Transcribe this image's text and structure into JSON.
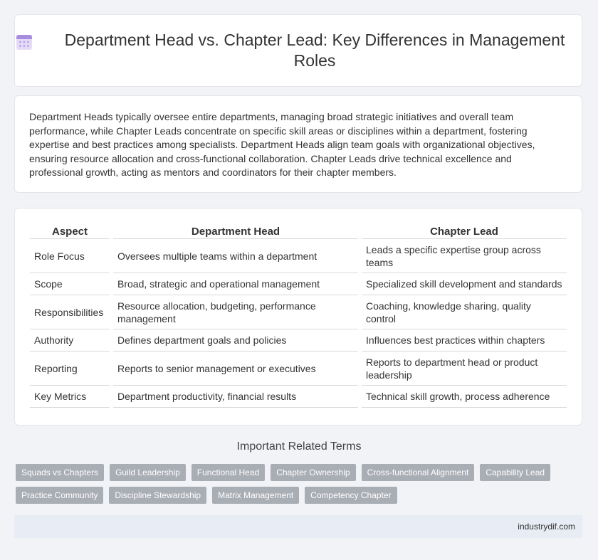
{
  "header": {
    "title": "Department Head vs. Chapter Lead: Key Differences in Management Roles",
    "icon": "calendar-icon"
  },
  "intro": {
    "text": "Department Heads typically oversee entire departments, managing broad strategic initiatives and overall team performance, while Chapter Leads concentrate on specific skill areas or disciplines within a department, fostering expertise and best practices among specialists. Department Heads align team goals with organizational objectives, ensuring resource allocation and cross-functional collaboration. Chapter Leads drive technical excellence and professional growth, acting as mentors and coordinators for their chapter members."
  },
  "table": {
    "headers": [
      "Aspect",
      "Department Head",
      "Chapter Lead"
    ],
    "rows": [
      [
        "Role Focus",
        "Oversees multiple teams within a department",
        "Leads a specific expertise group across teams"
      ],
      [
        "Scope",
        "Broad, strategic and operational management",
        "Specialized skill development and standards"
      ],
      [
        "Responsibilities",
        "Resource allocation, budgeting, performance management",
        "Coaching, knowledge sharing, quality control"
      ],
      [
        "Authority",
        "Defines department goals and policies",
        "Influences best practices within chapters"
      ],
      [
        "Reporting",
        "Reports to senior management or executives",
        "Reports to department head or product leadership"
      ],
      [
        "Key Metrics",
        "Department productivity, financial results",
        "Technical skill growth, process adherence"
      ]
    ]
  },
  "related": {
    "title": "Important Related Terms",
    "tags_row1": [
      "Squads vs Chapters",
      "Guild Leadership",
      "Functional Head",
      "Chapter Ownership",
      "Cross-functional Alignment",
      "Capability Lead"
    ],
    "tags_row2": [
      "Practice Community",
      "Discipline Stewardship",
      "Matrix Management",
      "Competency Chapter"
    ]
  },
  "footer": {
    "site": "industrydif.com"
  },
  "colors": {
    "background": "#f1f3f7",
    "tag": "#a9adb4",
    "footer": "#e8ecf5",
    "icon_accent": "#9a7fd6"
  }
}
